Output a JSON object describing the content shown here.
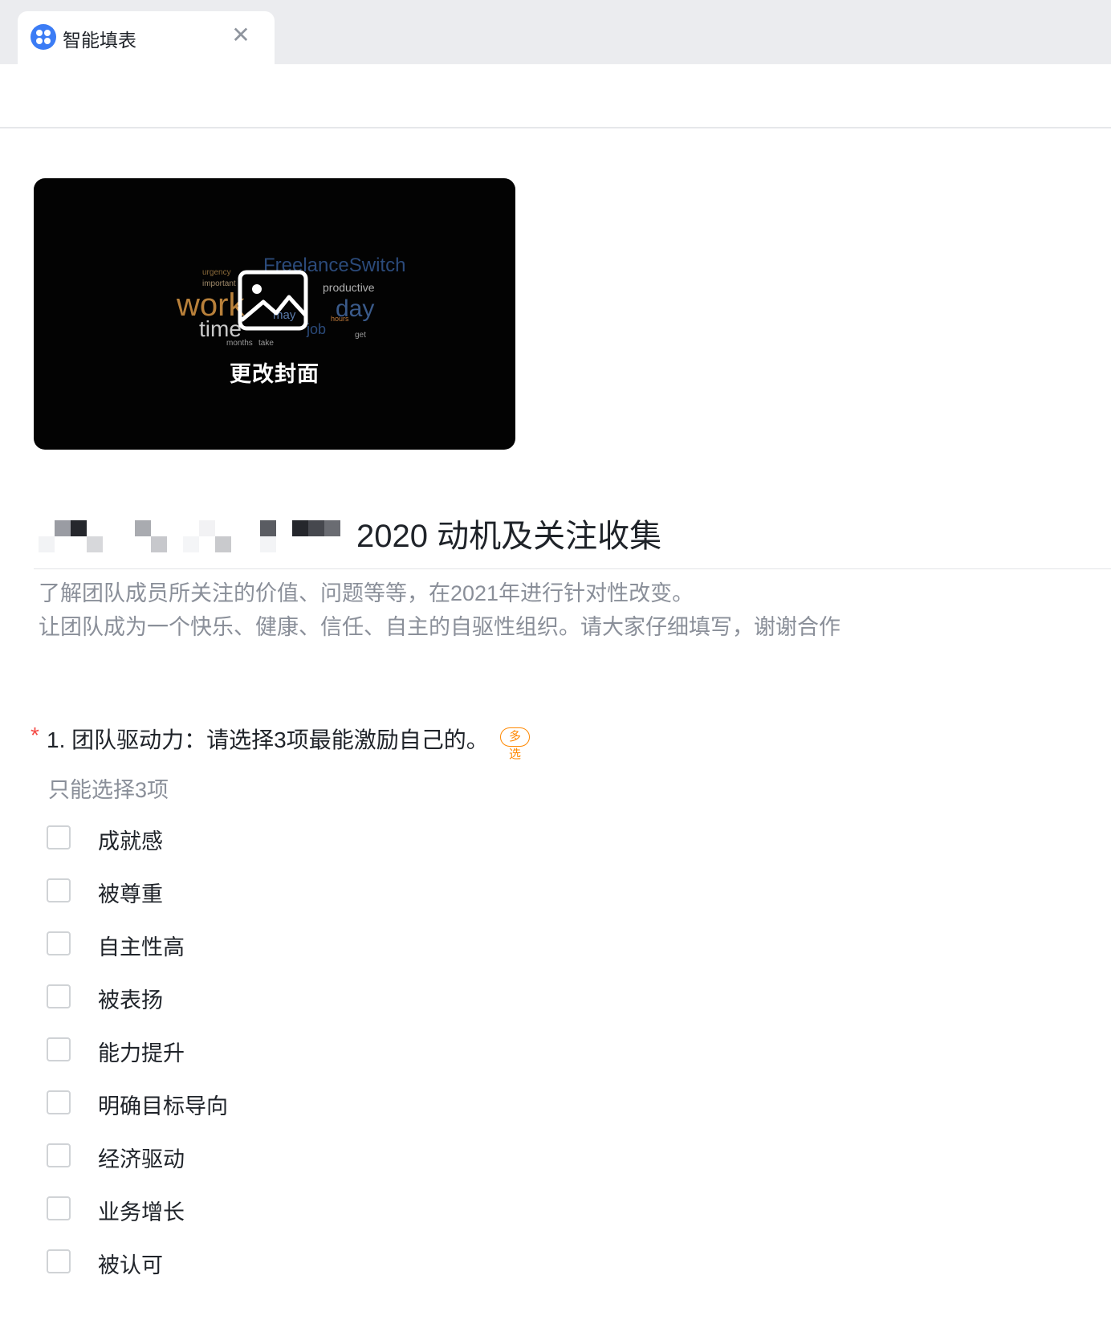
{
  "tab": {
    "title": "智能填表",
    "close_glyph": "✕",
    "logo_icon": "app-logo-icon"
  },
  "cover": {
    "change_label": "更改封面",
    "icon": "image-icon"
  },
  "form": {
    "title": "2020 动机及关注收集",
    "description_lines": [
      "了解团队成员所关注的价值、问题等等，在2021年进行针对性改变。",
      "让团队成为一个快乐、健康、信任、自主的自驱性组织。请大家仔细填写，谢谢合作"
    ]
  },
  "question": {
    "required_mark": "*",
    "title": "1. 团队驱动力：请选择3项最能激励自己的。",
    "badge": "多选",
    "hint": "只能选择3项",
    "options": [
      "成就感",
      "被尊重",
      "自主性高",
      "被表扬",
      "能力提升",
      "明确目标导向",
      "经济驱动",
      "业务增长",
      "被认可"
    ]
  },
  "colors": {
    "accent": "#3b7cf5",
    "required": "#f54a45",
    "badge": "#ff8800"
  }
}
